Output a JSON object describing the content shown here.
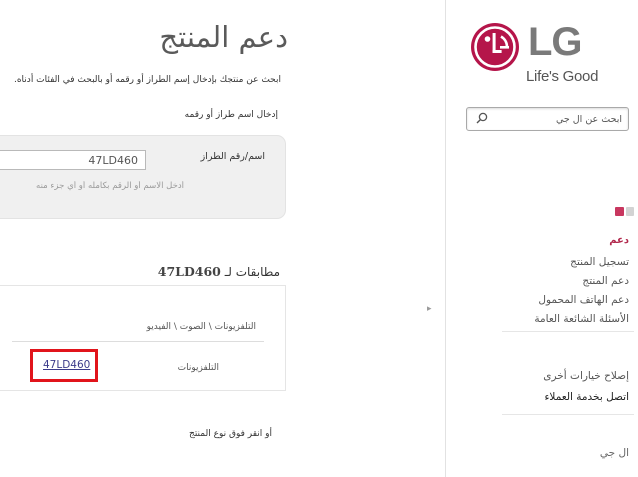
{
  "brand": {
    "logo_text": "LG",
    "tagline": "Life's Good",
    "accent_color": "#c8375f",
    "logo_color": "#b5154a"
  },
  "sidebar": {
    "search_placeholder": "ابحث عن ال جي",
    "nav_heading": "دعم",
    "nav_items": [
      "تسجيل المنتج",
      "دعم المنتج",
      "دعم الهاتف المحمول",
      "الأسئلة الشائعة العامة"
    ],
    "secondary_items": [
      "إصلاح خيارات أخرى",
      "اتصل بخدمة العملاء"
    ],
    "footer_text": "ال جي"
  },
  "main": {
    "page_title": "دعم المنتج",
    "intro_text": "ابحث عن منتجك بإدخال إسم الطراز أو رقمه أو بالبحث في الفئات أدناه.",
    "enter_label": "إدخال اسم طراز أو رقمه",
    "field_label": "اسم/رقم الطراز",
    "model_input_value": "47LD460",
    "hint_text": "أدخل الاسم أو الرقم بكامله أو أي جزء منه",
    "matches_prefix": "مطابقات لـ",
    "matches_model": "47LD460",
    "category_path": "التلفزيونات \\ الصوت \\ الفيديو",
    "category_name": "التلفزيونات",
    "result_link": "47LD460",
    "or_hover_text": "أو انقر فوق نوع المنتج"
  },
  "ui": {
    "highlight_color": "#e1141b",
    "collapse_arrow": "▸"
  }
}
